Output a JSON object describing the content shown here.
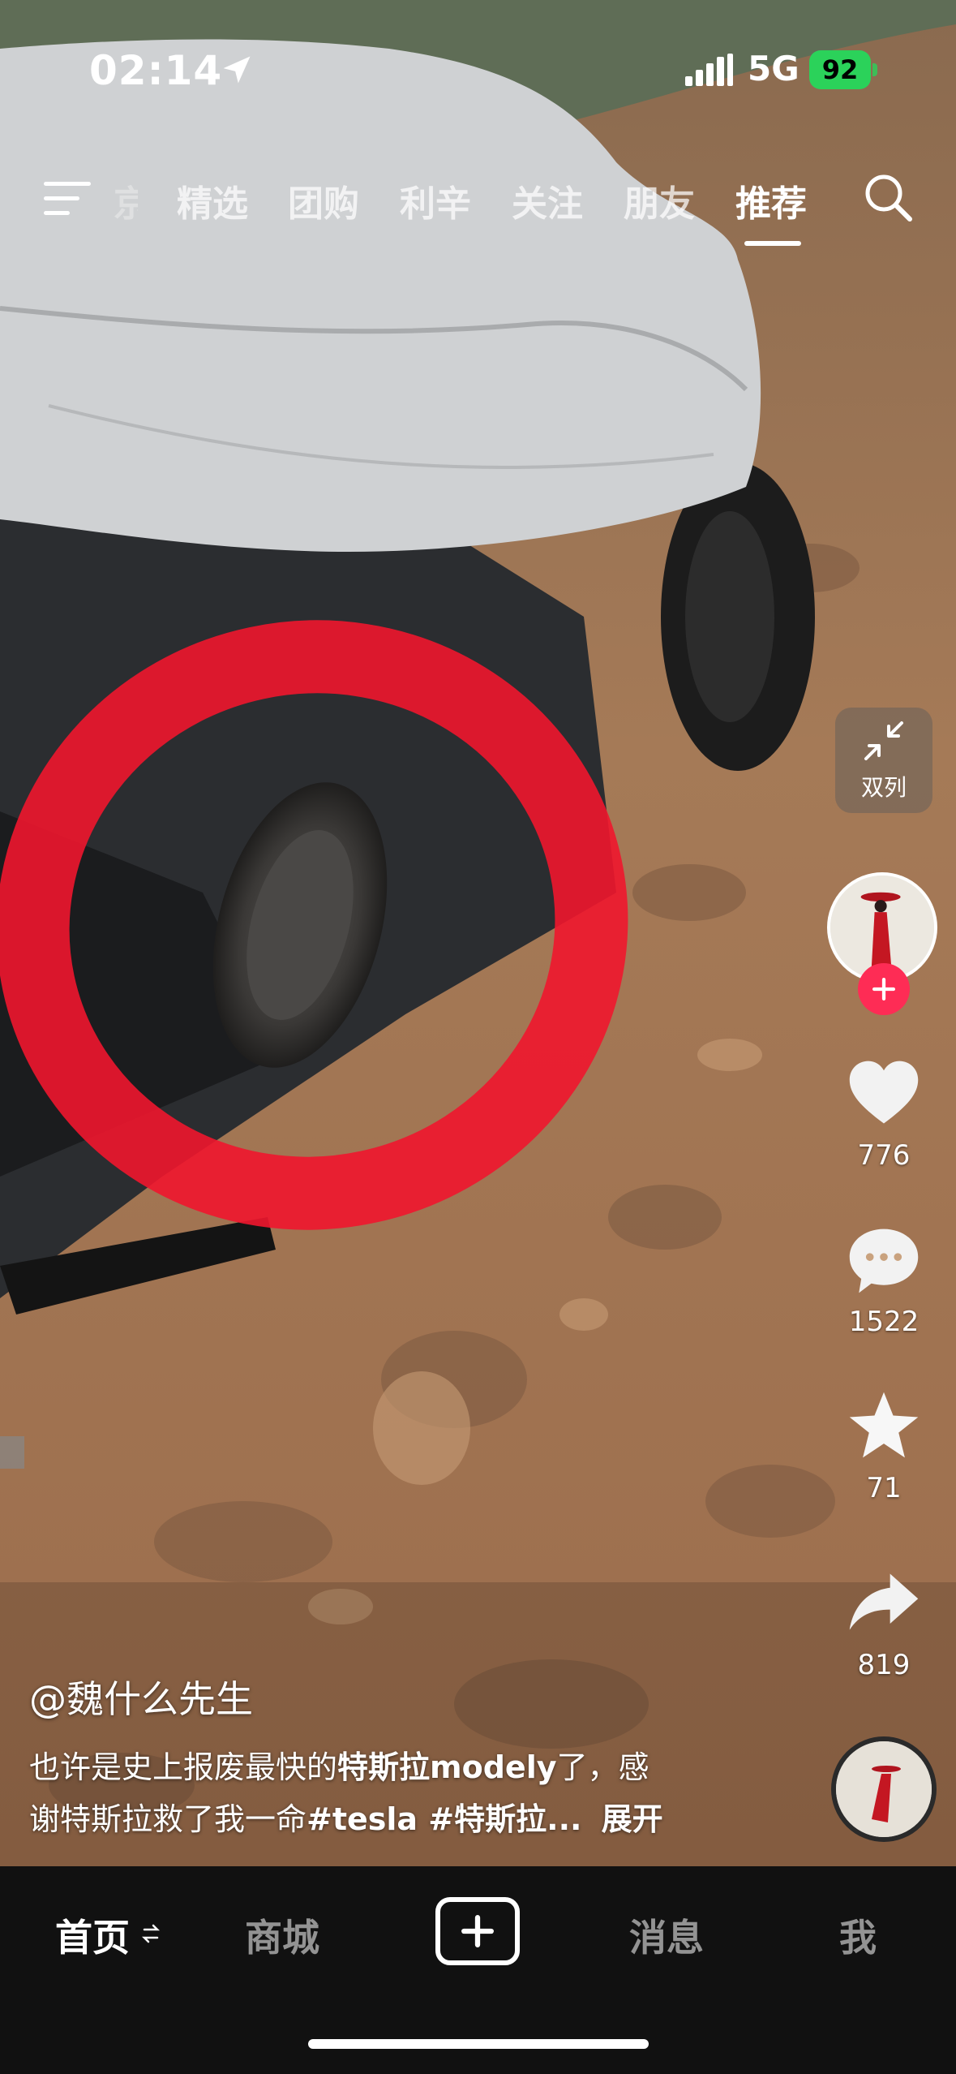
{
  "status_bar": {
    "time": "02:14",
    "network": "5G",
    "battery": "92"
  },
  "top_tabs": [
    {
      "label": "京",
      "active": false
    },
    {
      "label": "精选",
      "active": false
    },
    {
      "label": "团购",
      "active": false
    },
    {
      "label": "利辛",
      "active": false
    },
    {
      "label": "关注",
      "active": false
    },
    {
      "label": "朋友",
      "active": false
    },
    {
      "label": "推荐",
      "active": true
    }
  ],
  "side": {
    "dual_label": "双列",
    "likes": "776",
    "comments": "1522",
    "favorites": "71",
    "shares": "819"
  },
  "post": {
    "author": "@魏什么先生",
    "caption_line1_a": "也许是史上报废最快的",
    "caption_line1_link": "特斯拉modely",
    "caption_line1_b": "了，感",
    "caption_line2_a": "谢特斯拉救了我一命",
    "caption_line2_tags": "#tesla #特斯拉...",
    "expand": "展开"
  },
  "bottom_nav": {
    "home": "首页",
    "mall": "商城",
    "messages": "消息",
    "me": "我"
  },
  "colors": {
    "accent_red": "#fe2c55",
    "battery_green": "#2bd25a"
  }
}
